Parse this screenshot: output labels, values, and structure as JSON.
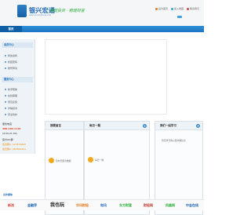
{
  "header": {
    "logo_text": "银兴宏通",
    "logo_sub": "www.yinxinghong.com",
    "slogan": "稳健投资 · 稳健财富",
    "links": [
      "设为首页",
      "加入收藏",
      "联系我们"
    ]
  },
  "nav": {
    "home_label": "首页"
  },
  "sidebar": {
    "section1_title": "会员中心",
    "section1_items": [
      "修改资料",
      "找回密码",
      "账号申诉"
    ],
    "section2_title": "服务中心",
    "section2_items": [
      "新手帮助",
      "在线客服",
      "意见反馈",
      "诈骗投诉",
      "安全防护"
    ],
    "hotline_label": "服务电话",
    "hotline_number": "400-100-1110",
    "hotline_hours": "(9:00-21:00)",
    "service_label": "官方QQ群",
    "qq1": "会员群1: 123474605",
    "qq2": "会员群2: 987654321"
  },
  "boxes": [
    {
      "title": "我要留言",
      "message": "暂时无留言数据",
      "has_plus": false
    },
    {
      "title": "每日一题",
      "message": "每日一题",
      "has_plus": true
    },
    {
      "title": "我们一起学习",
      "message": "暂无学习的公告内容信息",
      "has_plus": true
    }
  ],
  "partners": {
    "label": "合作媒体",
    "items": [
      "新浪",
      "金融界",
      "我也玩",
      "华讯财经",
      "和讯",
      "东方财富",
      "财经网",
      "凤凰网",
      "中金在线"
    ]
  },
  "colors": {
    "brand": "#1e66b4",
    "nav": "#1d74be",
    "accent": "#f2a818"
  }
}
